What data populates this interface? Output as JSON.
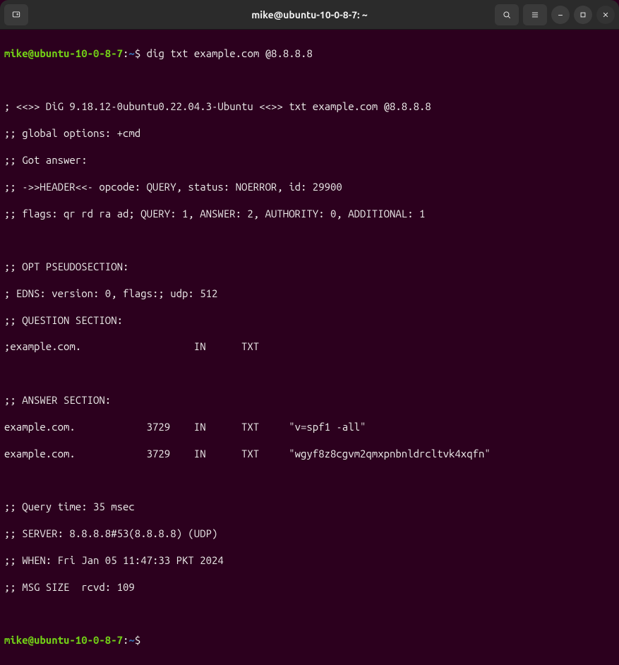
{
  "window": {
    "title": "mike@ubuntu-10-0-8-7: ~"
  },
  "prompt1": {
    "user": "mike@ubuntu-10-0-8-7",
    "colon": ":",
    "path": "~",
    "dollar": "$ ",
    "cmd": "dig txt example.com @8.8.8.8"
  },
  "output": {
    "l1": "",
    "l2": "; <<>> DiG 9.18.12-0ubuntu0.22.04.3-Ubuntu <<>> txt example.com @8.8.8.8",
    "l3": ";; global options: +cmd",
    "l4": ";; Got answer:",
    "l5": ";; ->>HEADER<<- opcode: QUERY, status: NOERROR, id: 29900",
    "l6": ";; flags: qr rd ra ad; QUERY: 1, ANSWER: 2, AUTHORITY: 0, ADDITIONAL: 1",
    "l7": "",
    "l8": ";; OPT PSEUDOSECTION:",
    "l9": "; EDNS: version: 0, flags:; udp: 512",
    "l10": ";; QUESTION SECTION:",
    "l11": ";example.com.                   IN      TXT",
    "l12": "",
    "l13": ";; ANSWER SECTION:",
    "l14": "example.com.            3729    IN      TXT     \"v=spf1 -all\"",
    "l15": "example.com.            3729    IN      TXT     \"wgyf8z8cgvm2qmxpnbnldrcltvk4xqfn\"",
    "l16": "",
    "l17": ";; Query time: 35 msec",
    "l18": ";; SERVER: 8.8.8.8#53(8.8.8.8) (UDP)",
    "l19": ";; WHEN: Fri Jan 05 11:47:33 PKT 2024",
    "l20": ";; MSG SIZE  rcvd: 109",
    "l21": ""
  },
  "prompt2": {
    "user": "mike@ubuntu-10-0-8-7",
    "colon": ":",
    "path": "~",
    "dollar": "$ ",
    "cmd": ""
  }
}
